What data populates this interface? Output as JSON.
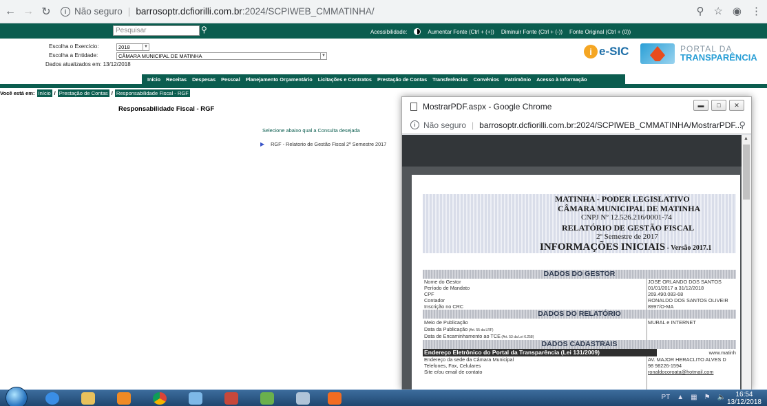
{
  "browser": {
    "not_secure": "Não seguro",
    "url_host": "barrosoptr.dcfiorilli.com.br",
    "url_path": ":2024/SCPIWEB_CMMATINHA/"
  },
  "site": {
    "search_placeholder": "Pesquisar",
    "accessibility_label": "Acessibilidade:",
    "font_increase": "Aumentar Fonte (Ctrl + (+))",
    "font_decrease": "Diminuir Fonte (Ctrl + (-))",
    "font_original": "Fonte Original (Ctrl + (0))",
    "exercise_label": "Escolha o Exercício:",
    "exercise_value": "2018",
    "entity_label": "Escolha a Entidade:",
    "entity_value": "CÂMARA MUNICIPAL DE MATINHA",
    "updated_text": "Dados atualizados em: 13/12/2018",
    "esic_text": "e-SIC",
    "portal_line1": "PORTAL DA",
    "portal_line2": "TRANSPARÊNCIA",
    "menu": [
      "Início",
      "Receitas",
      "Despesas",
      "Pessoal",
      "Planejamento Orçamentário",
      "Licitações e Contratos",
      "Prestação de Contas",
      "Transferências",
      "Convênios",
      "Patrimônio",
      "Acesso à Informação"
    ],
    "breadcrumb_label": "Você está em:",
    "breadcrumb": [
      "Início",
      "Prestação de Contas",
      "Responsabilidade Fiscal - RGF"
    ],
    "page_title": "Responsabilidade Fiscal - RGF",
    "select_prompt": "Selecione abaixo qual a Consulta desejada",
    "report_item": "RGF - Relatorio de Gestão Fiscal 2º Semestre 2017"
  },
  "popup": {
    "window_title": "MostrarPDF.aspx - Google Chrome",
    "not_secure": "Não seguro",
    "url": "barrosoptr.dcfiorilli.com.br:2024/SCPIWEB_CMMATINHA/MostrarPDF..."
  },
  "pdf": {
    "line1": "MATINHA - PODER LEGISLATIVO",
    "line2": "CÂMARA MUNICIPAL DE  MATINHA",
    "line3": "CNPJ Nº 12.526.216/0001-74",
    "line4": "RELATÓRIO DE GESTÃO FISCAL",
    "line5": "2º Semestre de 2017",
    "line6": "INFORMAÇÕES INICIAIS",
    "line6b": " - Versão 2017.1",
    "sec_gestor": "DADOS DO GESTOR",
    "gestor_rows": [
      {
        "label": "Nome do Gestor",
        "value": "JOSE ORLANDO DOS SANTOS"
      },
      {
        "label": "Período de Mandato",
        "value": "01/01/2017 a 31/12/2018"
      },
      {
        "label": "CPF",
        "value": "269.490.083-68"
      },
      {
        "label": "Contador",
        "value": "RONALDO DOS SANTOS OLIVEIR"
      },
      {
        "label": "Inscrição no CRC",
        "value": "8997/O-MA"
      }
    ],
    "sec_relatorio": "DADOS DO RELATÓRIO",
    "rel_publicacao": "Meio de Publicação",
    "rel_publicacao_value": "MURAL e INTERNET",
    "rel_data_pub": "Data da Publicação",
    "rel_data_pub_note": " (Art. 55 da LRF)",
    "rel_data_tce": "Data de Encaminhamento ao TCE",
    "rel_data_tce_note": " (Art. 53 da Lei 6.258)",
    "sec_cadastrais": "DADOS CADASTRAIS",
    "portal_row": "Endereço Eletrônico do Portal da Transparência (Lei 131/2009)",
    "portal_row_value": "www.matinh",
    "cad_rows": [
      {
        "label": "Endereço da sede da Câmara Municipal",
        "value": "AV. MAJOR HERACLITO ALVES D"
      },
      {
        "label": "Telefones, Fax, Celulares",
        "value": "98 98226-1594"
      },
      {
        "label": "Site e/ou email de contato",
        "value": "ronaldocoroata@hotmail.com"
      }
    ]
  },
  "taskbar": {
    "lang": "PT",
    "time": "16:54",
    "date": "13/12/2018"
  }
}
